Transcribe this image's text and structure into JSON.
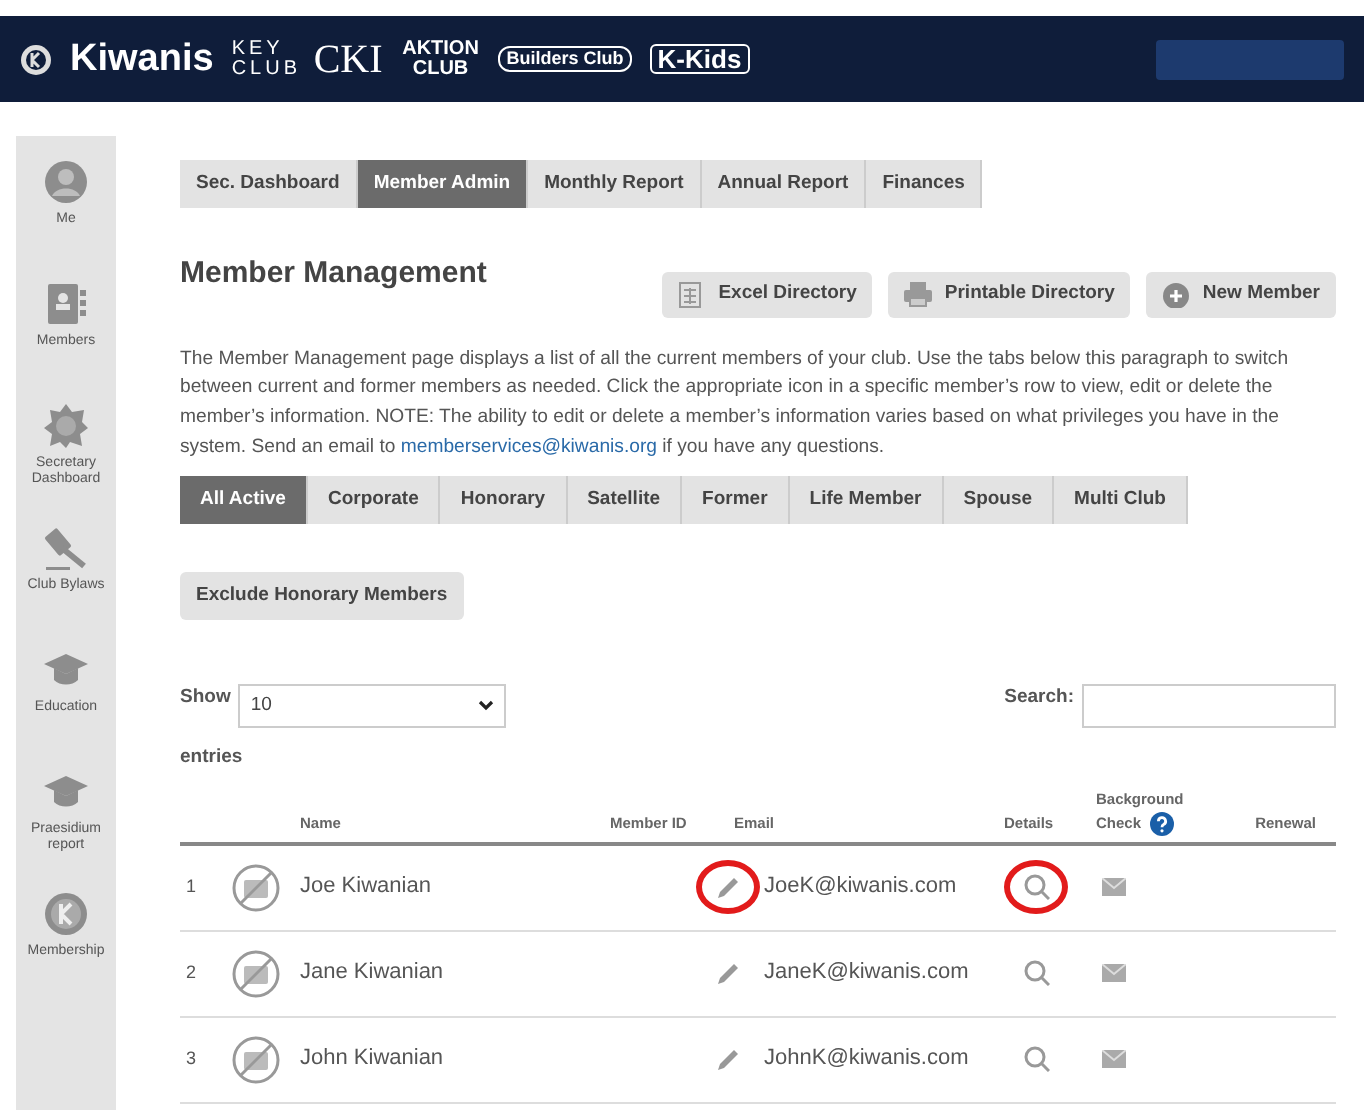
{
  "header": {
    "logos": [
      {
        "kind": "kiwanis",
        "text": "Kiwanis"
      },
      {
        "kind": "keyclub",
        "text": "KEY CLUB"
      },
      {
        "kind": "cki",
        "text": "CKI"
      },
      {
        "kind": "aktion",
        "text": "AKTION CLUB"
      },
      {
        "kind": "builders",
        "text": "Builders Club"
      },
      {
        "kind": "kkids",
        "text": "K-Kids"
      }
    ]
  },
  "sidebar": {
    "items": [
      {
        "kind": "person",
        "label": "Me"
      },
      {
        "kind": "book",
        "label": "Members"
      },
      {
        "kind": "badge",
        "label": "Secretary Dashboard"
      },
      {
        "kind": "gavel",
        "label": "Club Bylaws"
      },
      {
        "kind": "cap",
        "label": "Education"
      },
      {
        "kind": "cap",
        "label": "Praesidium report"
      },
      {
        "kind": "k",
        "label": "Membership"
      }
    ]
  },
  "tabs": [
    {
      "label": "Sec. Dashboard",
      "selected": false
    },
    {
      "label": "Member Admin",
      "selected": true
    },
    {
      "label": "Monthly Report",
      "selected": false
    },
    {
      "label": "Annual Report",
      "selected": false
    },
    {
      "label": "Finances",
      "selected": false
    }
  ],
  "title": "Member Management",
  "actions": [
    {
      "kind": "sheet",
      "label": "Excel Directory"
    },
    {
      "kind": "printer",
      "label": "Printable Directory"
    },
    {
      "kind": "plus",
      "label": "New Member"
    }
  ],
  "description": "The Member Management page displays a list of all the current members of your club. Use the tabs below this paragraph to switch between current and former members as needed. Click the appropriate icon in a specific member’s row to view, edit or delete the member’s information. NOTE: The ability to edit or delete a member’s information varies based on what privileges you have in the system. Send an email to ",
  "description_link": "memberservices@kiwanis.org",
  "description_end": " if you have any questions.",
  "filters": [
    {
      "label": "All Active",
      "selected": true
    },
    {
      "label": "Corporate",
      "selected": false
    },
    {
      "label": "Honorary",
      "selected": false
    },
    {
      "label": "Satellite",
      "selected": false
    },
    {
      "label": "Former",
      "selected": false
    },
    {
      "label": "Life Member",
      "selected": false
    },
    {
      "label": "Spouse",
      "selected": false
    },
    {
      "label": "Multi Club",
      "selected": false
    }
  ],
  "exclude_button": "Exclude Honorary Members",
  "show_label": "Show",
  "show_value": "10",
  "entries_label": "entries",
  "search_label": "Search:",
  "table": {
    "columns": [
      "Name",
      "Member ID",
      "Email",
      "Details",
      "Background Check",
      "Renewal"
    ],
    "rows": [
      {
        "number": "1",
        "name": "Joe Kiwanian",
        "email": "JoeK@kiwanis.com",
        "edit_circled": true,
        "details_circled": true
      },
      {
        "number": "2",
        "name": "Jane Kiwanian",
        "email": "JaneK@kiwanis.com",
        "edit_circled": false,
        "details_circled": false
      },
      {
        "number": "3",
        "name": "John Kiwanian",
        "email": "JohnK@kiwanis.com",
        "edit_circled": false,
        "details_circled": false
      }
    ]
  }
}
